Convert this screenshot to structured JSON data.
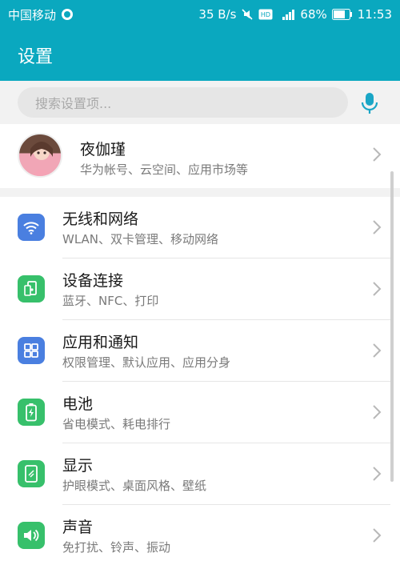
{
  "status": {
    "carrier": "中国移动",
    "speed": "35 B/s",
    "battery": "68%",
    "time": "11:53"
  },
  "header": {
    "title": "设置"
  },
  "search": {
    "placeholder": "搜索设置项..."
  },
  "profile": {
    "name": "夜伽瑾",
    "subtitle": "华为帐号、云空间、应用市场等"
  },
  "items": [
    {
      "title": "无线和网络",
      "subtitle": "WLAN、双卡管理、移动网络",
      "icon": "wifi-icon",
      "color": "#4a7fe0"
    },
    {
      "title": "设备连接",
      "subtitle": "蓝牙、NFC、打印",
      "icon": "device-connect-icon",
      "color": "#37c06b"
    },
    {
      "title": "应用和通知",
      "subtitle": "权限管理、默认应用、应用分身",
      "icon": "apps-icon",
      "color": "#4a7fe0"
    },
    {
      "title": "电池",
      "subtitle": "省电模式、耗电排行",
      "icon": "battery-icon",
      "color": "#37c06b"
    },
    {
      "title": "显示",
      "subtitle": "护眼模式、桌面风格、壁纸",
      "icon": "display-icon",
      "color": "#37c06b"
    },
    {
      "title": "声音",
      "subtitle": "免打扰、铃声、振动",
      "icon": "sound-icon",
      "color": "#37c06b"
    }
  ],
  "colors": {
    "accent": "#0aa8bf",
    "blue_icon": "#4a7fe0",
    "green_icon": "#37c06b"
  }
}
